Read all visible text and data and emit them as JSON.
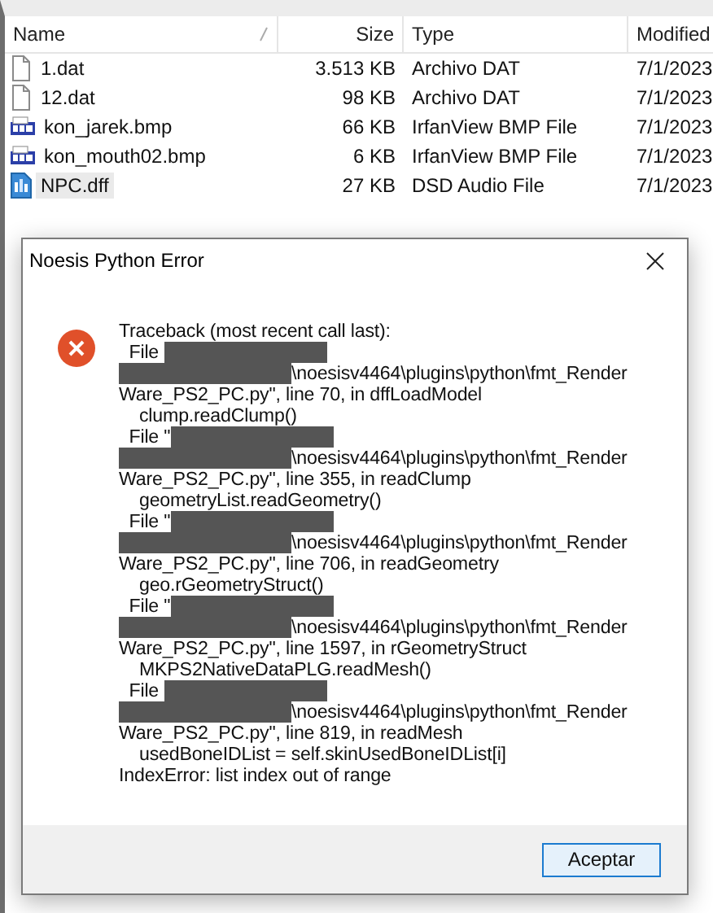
{
  "file_list": {
    "columns": [
      {
        "label": "Name",
        "sort_indicator": true
      },
      {
        "label": "Size",
        "sort_indicator": false
      },
      {
        "label": "Type",
        "sort_indicator": false
      },
      {
        "label": "Modified",
        "sort_indicator": false
      }
    ],
    "rows": [
      {
        "name": "1.dat",
        "kind": "blank",
        "size": "3.513 KB",
        "type": "Archivo DAT",
        "modified": "7/1/2023",
        "selected": false
      },
      {
        "name": "12.dat",
        "kind": "blank",
        "size": "98 KB",
        "type": "Archivo DAT",
        "modified": "7/1/2023",
        "selected": false
      },
      {
        "name": "kon_jarek.bmp",
        "kind": "bmp",
        "size": "66 KB",
        "type": "IrfanView BMP File",
        "modified": "7/1/2023",
        "selected": false
      },
      {
        "name": "kon_mouth02.bmp",
        "kind": "bmp",
        "size": "6 KB",
        "type": "IrfanView BMP File",
        "modified": "7/1/2023",
        "selected": false
      },
      {
        "name": "NPC.dff",
        "kind": "audio",
        "size": "27 KB",
        "type": "DSD Audio File",
        "modified": "7/1/2023",
        "selected": true
      }
    ]
  },
  "dialog": {
    "title": "Noesis Python Error",
    "lines": [
      [
        {
          "kind": "text",
          "text": "Traceback (most recent call last):"
        }
      ],
      [
        {
          "kind": "text",
          "text": "  File "
        },
        {
          "kind": "redacted"
        }
      ],
      [
        {
          "kind": "redacted"
        },
        {
          "kind": "text",
          "text": "\\noesisv4464\\plugins\\python\\fmt_Render"
        }
      ],
      [
        {
          "kind": "text",
          "text": "Ware_PS2_PC.py\", line 70, in dffLoadModel"
        }
      ],
      [
        {
          "kind": "text",
          "text": "    clump.readClump()"
        }
      ],
      [
        {
          "kind": "text",
          "text": "  File \""
        },
        {
          "kind": "redacted"
        }
      ],
      [
        {
          "kind": "redacted"
        },
        {
          "kind": "text",
          "text": "\\noesisv4464\\plugins\\python\\fmt_Render"
        }
      ],
      [
        {
          "kind": "text",
          "text": "Ware_PS2_PC.py\", line 355, in readClump"
        }
      ],
      [
        {
          "kind": "text",
          "text": "    geometryList.readGeometry()"
        }
      ],
      [
        {
          "kind": "text",
          "text": "  File \""
        },
        {
          "kind": "redacted"
        }
      ],
      [
        {
          "kind": "redacted"
        },
        {
          "kind": "text",
          "text": "\\noesisv4464\\plugins\\python\\fmt_Render"
        }
      ],
      [
        {
          "kind": "text",
          "text": "Ware_PS2_PC.py\", line 706, in readGeometry"
        }
      ],
      [
        {
          "kind": "text",
          "text": "    geo.rGeometryStruct()"
        }
      ],
      [
        {
          "kind": "text",
          "text": "  File \""
        },
        {
          "kind": "redacted"
        }
      ],
      [
        {
          "kind": "redacted"
        },
        {
          "kind": "text",
          "text": "\\noesisv4464\\plugins\\python\\fmt_Render"
        }
      ],
      [
        {
          "kind": "text",
          "text": "Ware_PS2_PC.py\", line 1597, in rGeometryStruct"
        }
      ],
      [
        {
          "kind": "text",
          "text": "    MKPS2NativeDataPLG.readMesh()"
        }
      ],
      [
        {
          "kind": "text",
          "text": "  File "
        },
        {
          "kind": "redacted"
        }
      ],
      [
        {
          "kind": "redacted"
        },
        {
          "kind": "text",
          "text": "\\noesisv4464\\plugins\\python\\fmt_Render"
        }
      ],
      [
        {
          "kind": "text",
          "text": "Ware_PS2_PC.py\", line 819, in readMesh"
        }
      ],
      [
        {
          "kind": "text",
          "text": "    usedBoneIDList = self.skinUsedBoneIDList[i]"
        }
      ],
      [
        {
          "kind": "text",
          "text": "IndexError: list index out of range"
        }
      ]
    ],
    "button": "Aceptar"
  }
}
